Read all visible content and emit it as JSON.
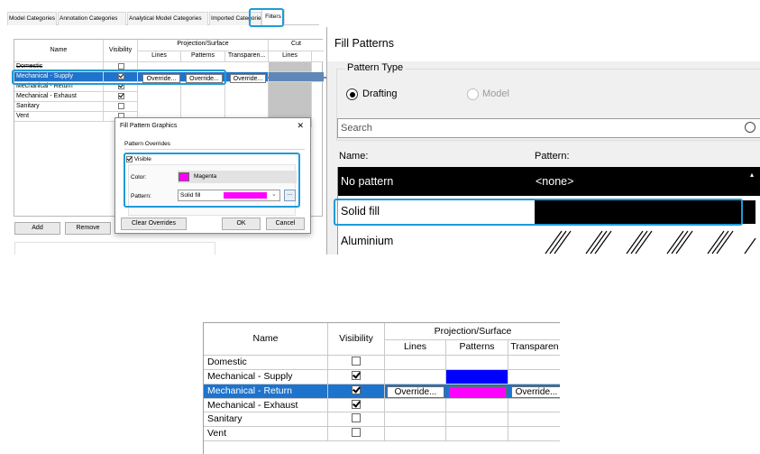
{
  "tabs": [
    "Model Categories",
    "Annotation Categories",
    "Analytical Model Categories",
    "Imported Categories",
    "Filters"
  ],
  "filters_table": {
    "headers": {
      "name": "Name",
      "visibility": "Visibility",
      "projection_surface": "Projection/Surface",
      "cut": "Cut",
      "lines": "Lines",
      "patterns": "Patterns",
      "transparency": "Transparen...",
      "cut_lines": "Lines"
    },
    "rows": [
      {
        "name": "Domestic",
        "visible": false
      },
      {
        "name": "Mechanical - Supply",
        "visible": true
      },
      {
        "name": "Mechanical - Return",
        "visible": true
      },
      {
        "name": "Mechanical - Exhaust",
        "visible": true
      },
      {
        "name": "Sanitary",
        "visible": false
      },
      {
        "name": "Vent",
        "visible": false
      }
    ],
    "override_label": "Override...",
    "add_label": "Add",
    "remove_label": "Remove"
  },
  "fill_pattern_graphics": {
    "title": "Fill Pattern Graphics",
    "close": "✕",
    "section": "Pattern Overrides",
    "visible_label": "Visible",
    "visible_checked": true,
    "color_label": "Color:",
    "color_value": "Magenta",
    "color_hex": "#ff00ff",
    "pattern_label": "Pattern:",
    "pattern_value": "Solid fill",
    "browse": "...",
    "clear_overrides": "Clear Overrides",
    "ok": "OK",
    "cancel": "Cancel"
  },
  "fill_patterns": {
    "title": "Fill Patterns",
    "pattern_type_label": "Pattern Type",
    "drafting_label": "Drafting",
    "model_label": "Model",
    "search_placeholder": "Search",
    "name_header": "Name:",
    "pattern_header": "Pattern:",
    "rows": [
      {
        "name": "No pattern",
        "pattern": "<none>"
      },
      {
        "name": "Solid fill",
        "pattern": ""
      },
      {
        "name": "Aluminium",
        "pattern": ""
      }
    ]
  },
  "result_table": {
    "headers": {
      "name": "Name",
      "visibility": "Visibility",
      "projection_surface": "Projection/Surface",
      "lines": "Lines",
      "patterns": "Patterns",
      "transparency": "Transparen"
    },
    "rows": [
      {
        "name": "Domestic",
        "visible": false
      },
      {
        "name": "Mechanical - Supply",
        "visible": true
      },
      {
        "name": "Mechanical - Return",
        "visible": true
      },
      {
        "name": "Mechanical - Exhaust",
        "visible": true
      },
      {
        "name": "Sanitary",
        "visible": false
      },
      {
        "name": "Vent",
        "visible": false
      }
    ],
    "override_label": "Override...",
    "supply_pattern_color": "#0000ff",
    "return_pattern_color": "#ff00ff",
    "selected_row_color": "#1e73cc"
  },
  "colors": {
    "highlight": "#1f9bd7"
  }
}
